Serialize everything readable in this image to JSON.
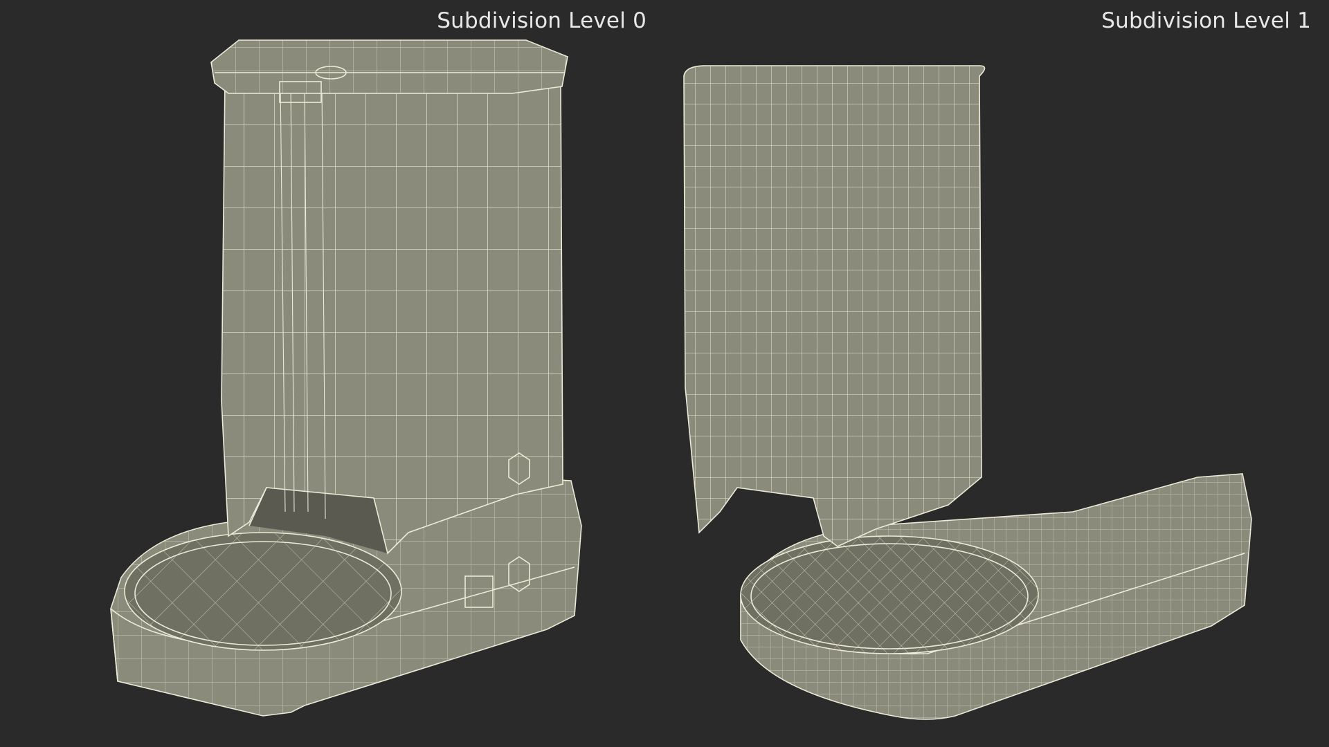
{
  "viewports": [
    {
      "label": "Subdivision Level 0",
      "subdivision_level": 0
    },
    {
      "label": "Subdivision Level 1",
      "subdivision_level": 1
    }
  ],
  "colors": {
    "background": "#2a2a2a",
    "mesh_fill": "#8b8b7c",
    "wire": "#ecebd8",
    "label_text": "#e8e8e8"
  }
}
